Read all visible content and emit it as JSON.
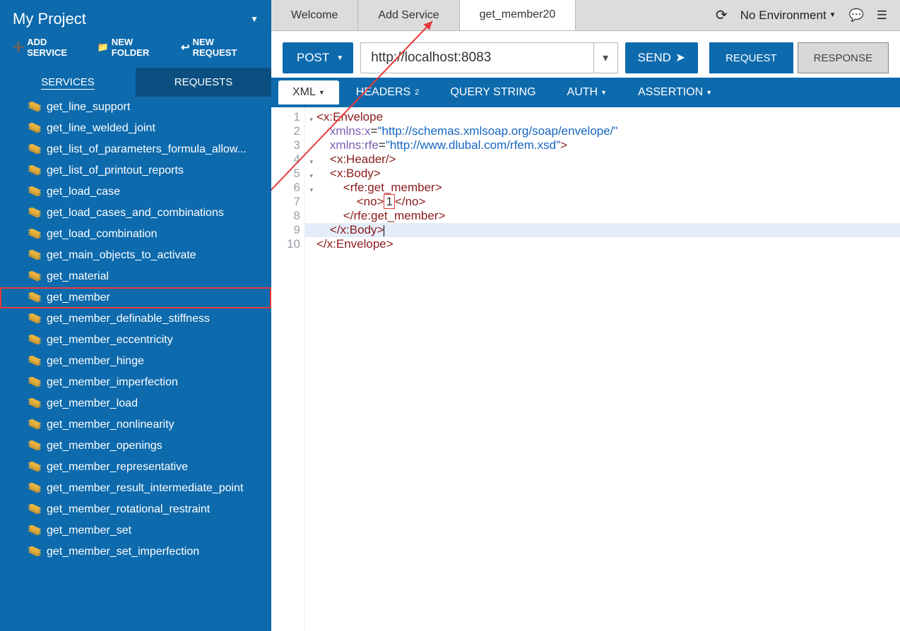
{
  "sidebar": {
    "project_title": "My Project",
    "actions": {
      "add_service": "ADD SERVICE",
      "new_folder": "NEW FOLDER",
      "new_request": "NEW REQUEST"
    },
    "tabs": {
      "services": "SERVICES",
      "requests": "REQUESTS"
    },
    "items": [
      "get_line_support",
      "get_line_welded_joint",
      "get_list_of_parameters_formula_allow...",
      "get_list_of_printout_reports",
      "get_load_case",
      "get_load_cases_and_combinations",
      "get_load_combination",
      "get_main_objects_to_activate",
      "get_material",
      "get_member",
      "get_member_definable_stiffness",
      "get_member_eccentricity",
      "get_member_hinge",
      "get_member_imperfection",
      "get_member_load",
      "get_member_nonlinearity",
      "get_member_openings",
      "get_member_representative",
      "get_member_result_intermediate_point",
      "get_member_rotational_restraint",
      "get_member_set",
      "get_member_set_imperfection"
    ],
    "highlight_index": 9
  },
  "topbar": {
    "tabs": [
      "Welcome",
      "Add Service",
      "get_member20"
    ],
    "active_tab": 2,
    "environment_label": "No Environment"
  },
  "request": {
    "method": "POST",
    "url": "http://localhost:8083",
    "send_label": "SEND",
    "view_tabs": {
      "request": "REQUEST",
      "response": "RESPONSE"
    }
  },
  "editor_tabs": {
    "xml": "XML",
    "headers": "HEADERS",
    "headers_count": "2",
    "query": "QUERY STRING",
    "auth": "AUTH",
    "assertion": "ASSERTION"
  },
  "code": {
    "lines": [
      {
        "n": "1",
        "fold": true
      },
      {
        "n": "2"
      },
      {
        "n": "3"
      },
      {
        "n": "4",
        "fold": true
      },
      {
        "n": "5",
        "fold": true
      },
      {
        "n": "6",
        "fold": true
      },
      {
        "n": "7"
      },
      {
        "n": "8"
      },
      {
        "n": "9"
      },
      {
        "n": "10"
      }
    ],
    "body": {
      "l1_open": "<x:Envelope",
      "l2_attr": "xmlns:x",
      "l2_val": "\"http://schemas.xmlsoap.org/soap/envelope/\"",
      "l3_attr": "xmlns:rfe",
      "l3_val": "\"http://www.dlubal.com/rfem.xsd\"",
      "l3_close": ">",
      "l4": "<x:Header/>",
      "l5": "<x:Body>",
      "l6": "<rfe:get_member>",
      "l7_open": "<no>",
      "l7_val": "1",
      "l7_close": "</no>",
      "l8": "</rfe:get_member>",
      "l9": "</x:Body>",
      "l10": "</x:Envelope>"
    }
  }
}
